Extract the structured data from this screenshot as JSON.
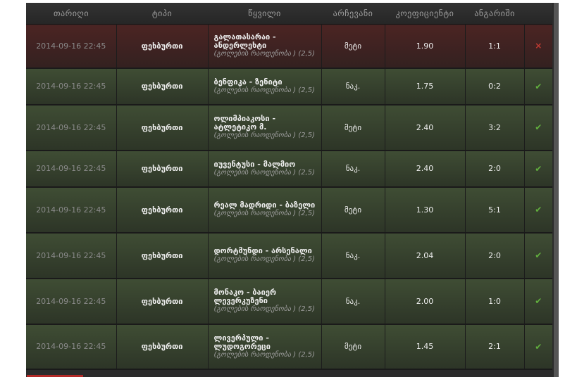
{
  "table": {
    "headers": [
      "თარიღი",
      "ტიპი",
      "წყვილი",
      "არჩევანი",
      "კოეფიციენტი",
      "ანგარიში"
    ],
    "rows": [
      {
        "date": "2014-09-16 22:45",
        "type": "ფეხბურთი",
        "match": "გალათასარაი - ანდერლეხტი",
        "detail": "(გოლების რაოდენობა ) (2,5)",
        "bet": "მეტი",
        "odds": "1.90",
        "score": "1:1",
        "result": "lost",
        "result_icon": "×"
      },
      {
        "date": "2014-09-16 22:45",
        "type": "ფეხბურთი",
        "match": "ბენფიკა - ზენიტი",
        "detail": "(გოლების რაოდენობა ) (2,5)",
        "bet": "ნაკ.",
        "odds": "1.75",
        "score": "0:2",
        "result": "won",
        "result_icon": "✔"
      },
      {
        "date": "2014-09-16 22:45",
        "type": "ფეხბურთი",
        "match": "ოლიმპიაკოსი - ატლეტიკო მ.",
        "detail": "(გოლების რაოდენობა ) (2,5)",
        "bet": "მეტი",
        "odds": "2.40",
        "score": "3:2",
        "result": "won",
        "result_icon": "✔"
      },
      {
        "date": "2014-09-16 22:45",
        "type": "ფეხბურთი",
        "match": "იუვენტუსი - მალმიო",
        "detail": "(გოლების რაოდენობა ) (2,5)",
        "bet": "ნაკ.",
        "odds": "2.40",
        "score": "2:0",
        "result": "won",
        "result_icon": "✔"
      },
      {
        "date": "2014-09-16 22:45",
        "type": "ფეხბურთი",
        "match": "რეალ მადრიდი - ბაზელი",
        "detail": "(გოლების რაოდენობა ) (2,5)",
        "bet": "მეტი",
        "odds": "1.30",
        "score": "5:1",
        "result": "won",
        "result_icon": "✔"
      },
      {
        "date": "2014-09-16 22:45",
        "type": "ფეხბურთი",
        "match": "დორტმუნდი - არსენალი",
        "detail": "(გოლების რაოდენობა ) (2,5)",
        "bet": "ნაკ.",
        "odds": "2.04",
        "score": "2:0",
        "result": "won",
        "result_icon": "✔"
      },
      {
        "date": "2014-09-16 22:45",
        "type": "ფეხბურთი",
        "match": "მონაკო - ბაიერ ლევერკუზენი",
        "detail": "(გოლების რაოდენობა ) (2,5)",
        "bet": "ნაკ.",
        "odds": "2.00",
        "score": "1:0",
        "result": "won",
        "result_icon": "✔"
      },
      {
        "date": "2014-09-16 22:45",
        "type": "ფეხბურთი",
        "match": "ლივერპული - ლუდოგორეცი",
        "detail": "(გოლების რაოდენობა ) (2,5)",
        "bet": "მეტი",
        "odds": "1.45",
        "score": "2:1",
        "result": "won",
        "result_icon": "✔"
      }
    ]
  },
  "colors": {
    "lost_row": "#3f2221",
    "won_row": "#36412d",
    "lost_icon": "#c23b32",
    "won_icon": "#62b03e"
  }
}
